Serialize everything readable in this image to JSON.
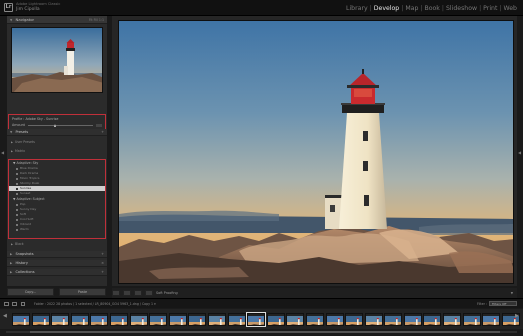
{
  "app": {
    "logo": "Lr",
    "identity_line1": "Adobe Lightroom Classic",
    "identity_line2": "Jim Cipolla"
  },
  "modules": {
    "items": [
      "Library",
      "Develop",
      "Map",
      "Book",
      "Slideshow",
      "Print",
      "Web"
    ],
    "active": "Develop"
  },
  "navigator": {
    "title": "Navigator",
    "zoom_options": "Fit  Fill  1:1"
  },
  "profile": {
    "label": "Profile : Adobe Sky - Sunrise",
    "amount_label": "Amount"
  },
  "presets": {
    "title": "Presets",
    "groups": [
      {
        "label": "User Presets"
      },
      {
        "label": "Matrix"
      }
    ],
    "list_group1": "Adaptive: Sky",
    "list_group1_items": [
      "Blue Drama",
      "Dark Drama",
      "Moon Tropics",
      "Stormy Dusk",
      "Sunrise",
      "Sunset"
    ],
    "selected_item": "Sunrise",
    "list_group2": "Adaptive: Subject",
    "list_group2_items": [
      "Pop",
      "Sunny Day",
      "Soft",
      "Cool Soft",
      "Vibrant",
      "Warm"
    ],
    "after_group": "Black"
  },
  "panels_below": [
    "Snapshots",
    "History",
    "Collections"
  ],
  "left_buttons": {
    "copy": "Copy...",
    "paste": "Paste"
  },
  "toolbar": {
    "label": "Soft Proofing"
  },
  "filmstrip_bar": {
    "text": "Folder : 2022   28 photos / 1 selected / LR_80904_GO4 5963_1.dng / Copy 1 ▾",
    "filter_label": "Filter :",
    "filter_value": "Filters Off"
  },
  "filmstrip": {
    "count": 26,
    "active_index": 12
  },
  "colors": {
    "accent_red": "#c0303a",
    "active_module": "#e6e6e6"
  }
}
